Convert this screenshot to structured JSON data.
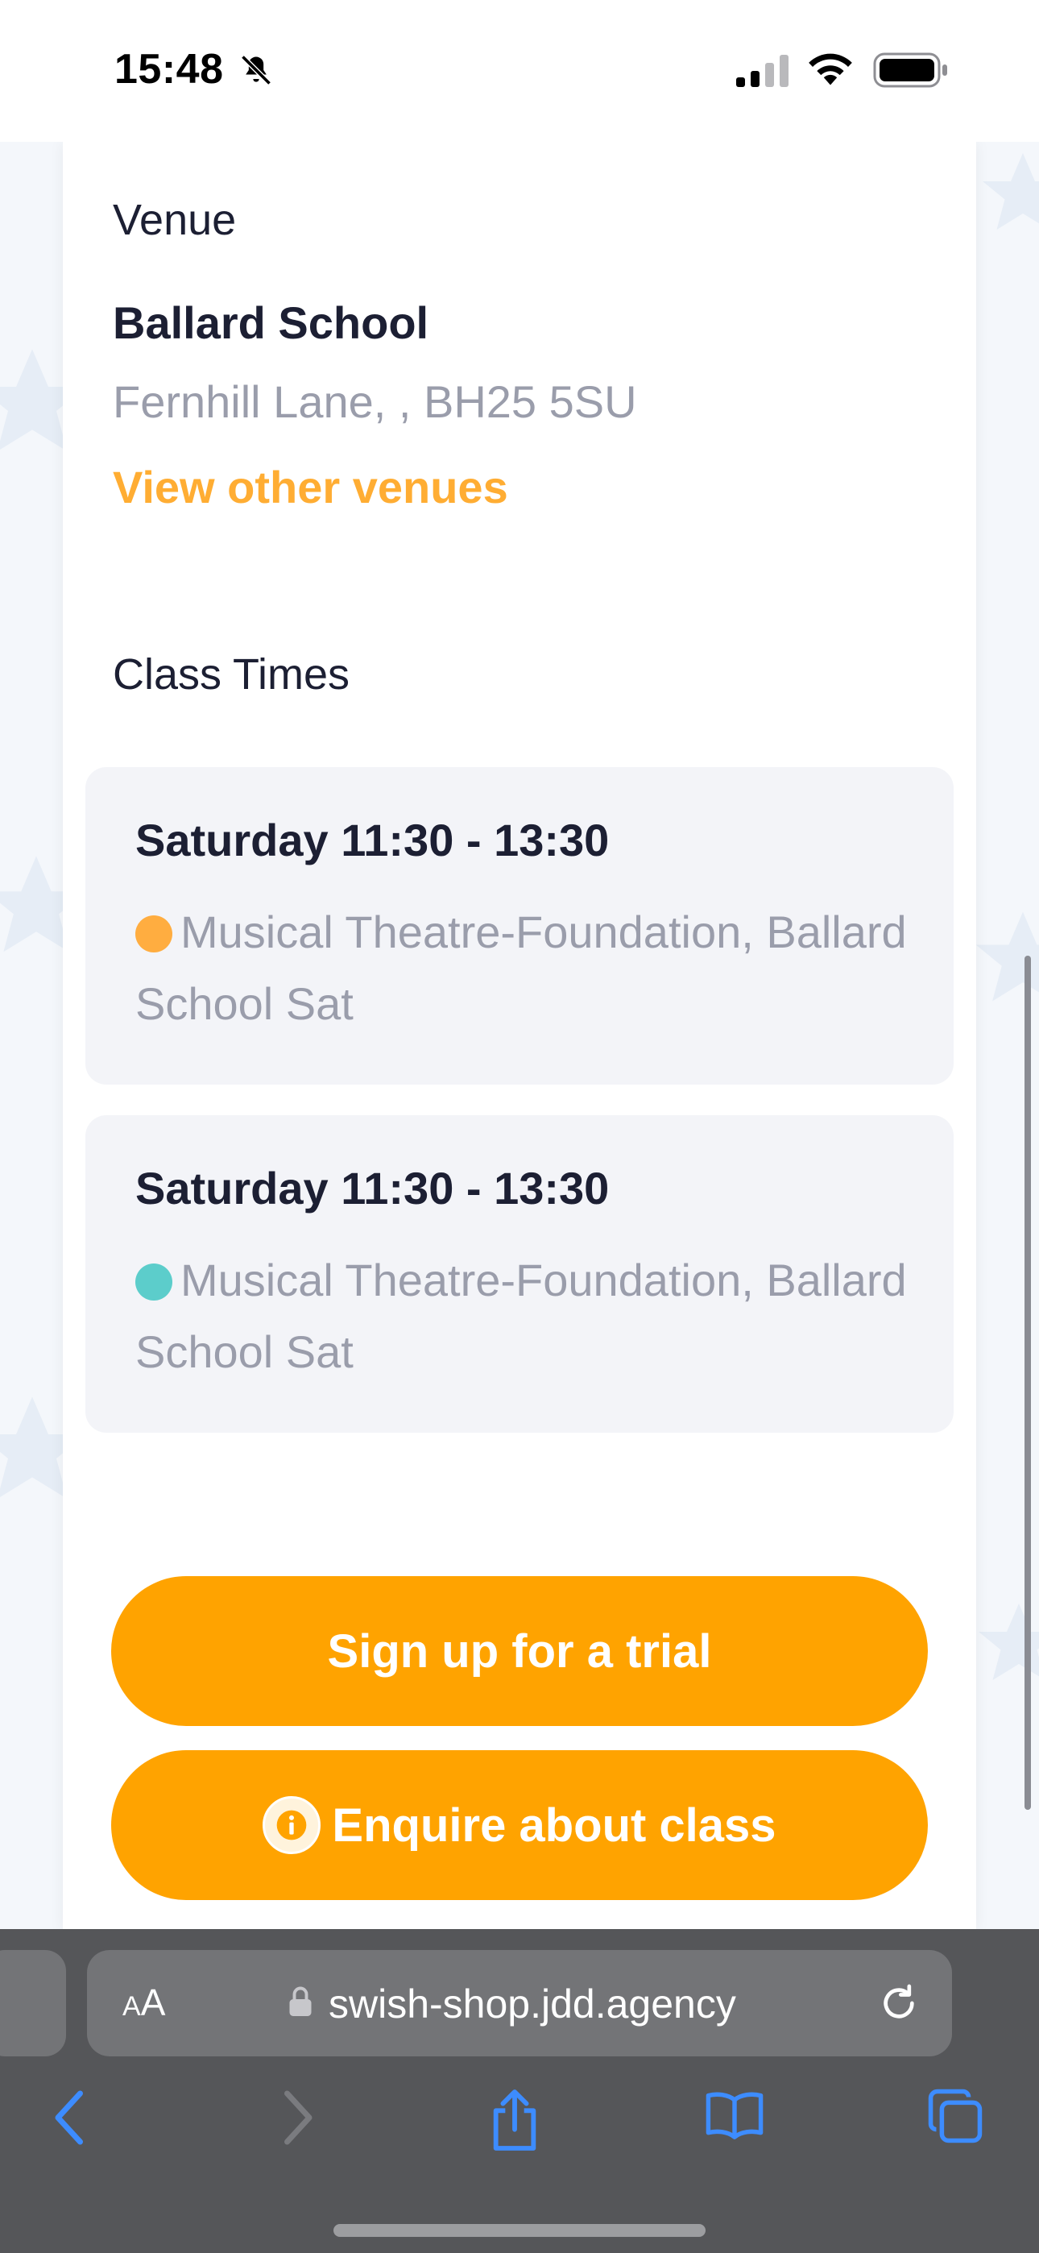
{
  "status_bar": {
    "time": "15:48",
    "icons": [
      "bell-slash-icon",
      "signal-icon",
      "wifi-icon",
      "battery-icon"
    ]
  },
  "venue": {
    "label": "Venue",
    "name": "Ballard School",
    "address": "Fernhill Lane, , BH25 5SU",
    "other_venues_link": "View other venues"
  },
  "class_times": {
    "label": "Class Times",
    "slots": [
      {
        "time": "Saturday 11:30 - 13:30",
        "description": "Musical Theatre-Foundation, Ballard School Sat",
        "dot_color": "#ffad40"
      },
      {
        "time": "Saturday 11:30 - 13:30",
        "description": "Musical Theatre-Foundation, Ballard School Sat",
        "dot_color": "#5ccdcb"
      }
    ]
  },
  "actions": {
    "trial_label": "Sign up for a trial",
    "enquire_label": "Enquire about class"
  },
  "browser": {
    "aa_label_small": "A",
    "aa_label_large": "A",
    "url": "swish-shop.jdd.agency",
    "toolbar_icons": [
      "back-icon",
      "forward-icon",
      "share-icon",
      "bookmarks-icon",
      "tabs-icon"
    ]
  },
  "colors": {
    "accent": "#ffa300",
    "link": "#ffad33",
    "safari_blue": "#3d8cff"
  }
}
